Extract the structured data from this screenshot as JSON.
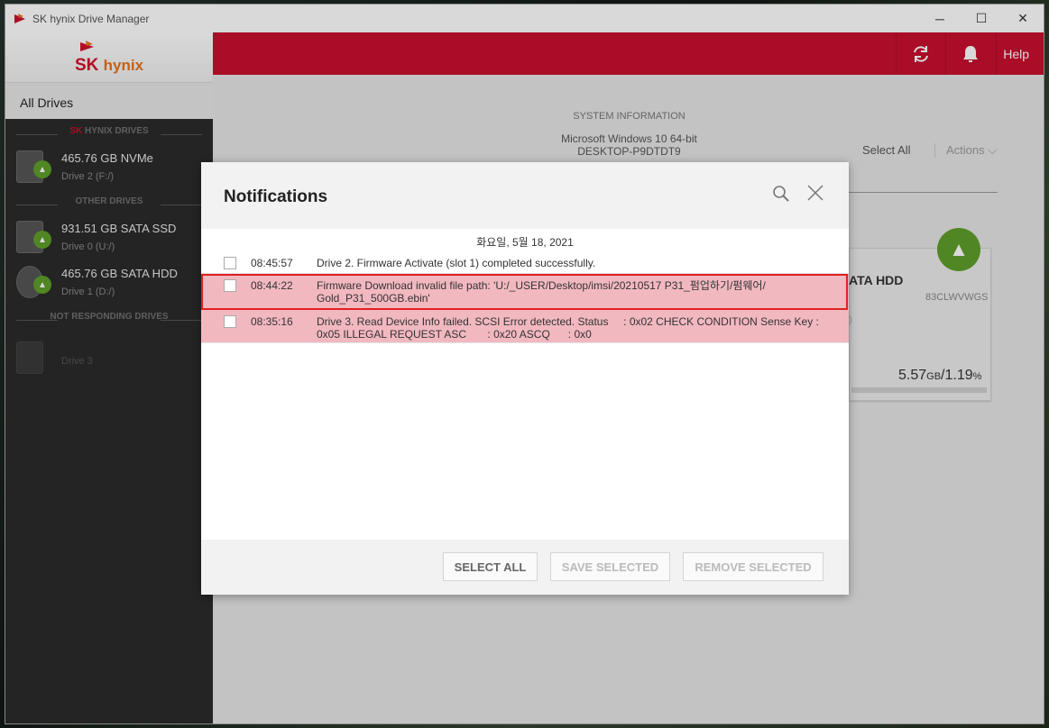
{
  "window": {
    "title": "SK hynix Drive Manager",
    "controls": {
      "minimize": "─",
      "maximize": "☐",
      "close": "✕"
    }
  },
  "sidebar": {
    "logo": {
      "sk": "SK",
      "hynix": "hynix"
    },
    "all_drives": "All Drives",
    "sections": [
      {
        "title_prefix": "SK",
        "title_rest": " HYNIX DRIVES"
      },
      {
        "title": "OTHER DRIVES"
      },
      {
        "title": "NOT RESPONDING DRIVES"
      }
    ],
    "drives": [
      {
        "name": "465.76 GB NVMe",
        "sub": "Drive 2 (F:/)",
        "thumb": "NVMe"
      },
      {
        "name": "931.51 GB SATA SSD",
        "sub": "Drive 0 (U:/)",
        "thumb": "SSD"
      },
      {
        "name": "465.76 GB SATA HDD",
        "sub": "Drive 1 (D:/)",
        "thumb": "HDD"
      },
      {
        "name": "",
        "sub": "Drive 3"
      }
    ]
  },
  "topbar": {
    "refresh_icon": "refresh-icon",
    "bell_icon": "bell-icon",
    "help": "Help"
  },
  "main": {
    "sys_header": "SYSTEM INFORMATION",
    "sys_os": "Microsoft Windows 10 64-bit",
    "sys_pc": "DESKTOP-P9DTDT9",
    "select_all": "Select All",
    "actions": "Actions ⌵",
    "card": {
      "name": "ATA HDD",
      "serial": "83CLWVWGS",
      "paren": ")",
      "used": "5.57",
      "used_unit": "GB",
      "pct": "/1.19",
      "pct_unit": "%"
    }
  },
  "modal": {
    "title": "Notifications",
    "date": "화요일, 5월 18, 2021",
    "rows": [
      {
        "time": "08:45:57",
        "msg": "Drive 2. Firmware Activate (slot 1) completed successfully."
      },
      {
        "time": "08:44:22",
        "msg": "Firmware Download invalid file path: 'U:/_USER/Desktop/imsi/20210517 P31_펌업하기/펌웨어/\nGold_P31_500GB.ebin'"
      },
      {
        "time": "08:35:16",
        "msg": "Drive 3. Read Device Info failed. SCSI Error detected. Status     : 0x02 CHECK CONDITION Sense Key :\n0x05 ILLEGAL REQUEST ASC       : 0x20 ASCQ      : 0x0"
      }
    ],
    "buttons": {
      "select_all": "SELECT ALL",
      "save_selected": "SAVE SELECTED",
      "remove_selected": "REMOVE SELECTED"
    }
  },
  "colors": {
    "brand_red": "#c8102e",
    "status_green": "#5e9e2a",
    "error_row": "#f2b8c0",
    "highlight": "#e02020"
  }
}
